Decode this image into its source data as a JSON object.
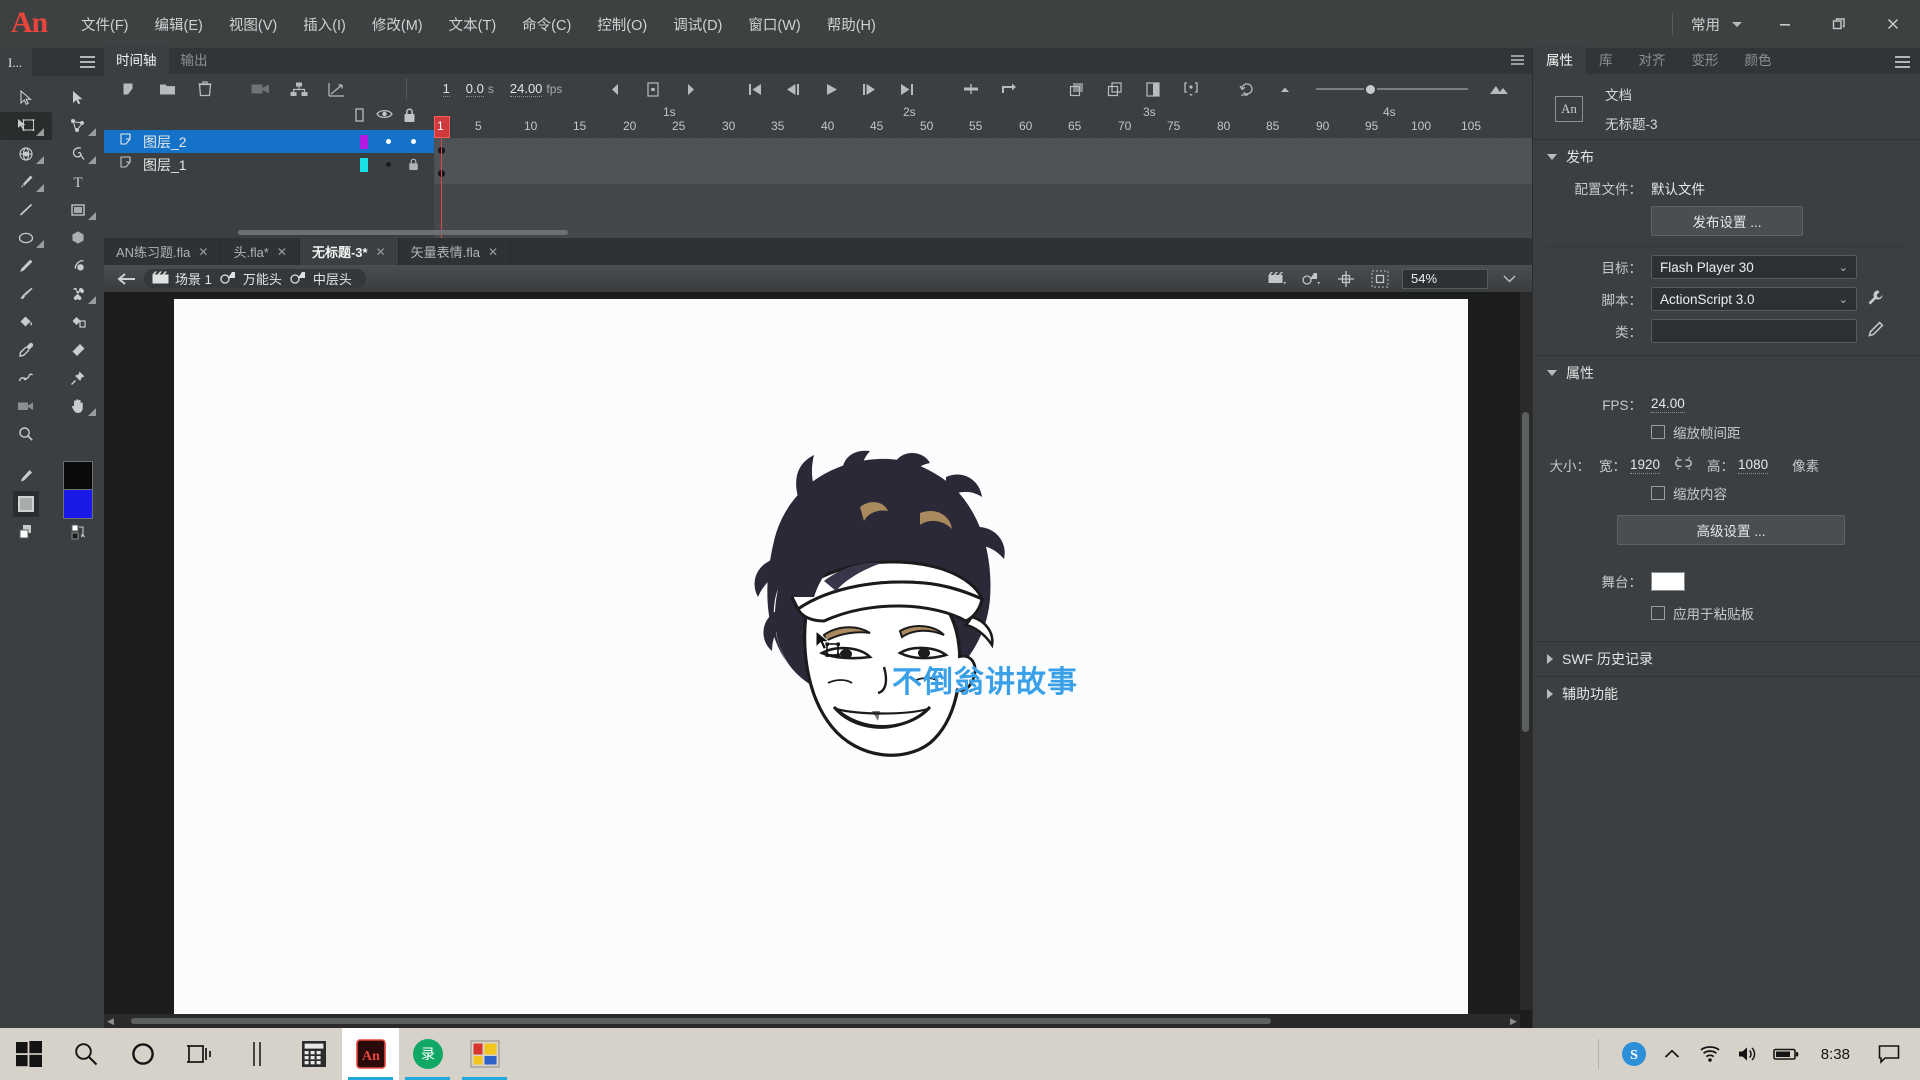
{
  "app": {
    "logo": "An",
    "workspace_label": "常用",
    "window_buttons": {
      "minimize": "minimize-icon",
      "restore": "restore-icon",
      "close": "close-icon"
    }
  },
  "menubar": {
    "items": [
      {
        "label": "文件(F)",
        "name": "menu-file"
      },
      {
        "label": "编辑(E)",
        "name": "menu-edit"
      },
      {
        "label": "视图(V)",
        "name": "menu-view"
      },
      {
        "label": "插入(I)",
        "name": "menu-insert"
      },
      {
        "label": "修改(M)",
        "name": "menu-modify"
      },
      {
        "label": "文本(T)",
        "name": "menu-text"
      },
      {
        "label": "命令(C)",
        "name": "menu-commands"
      },
      {
        "label": "控制(O)",
        "name": "menu-control"
      },
      {
        "label": "调试(D)",
        "name": "menu-debug"
      },
      {
        "label": "窗口(W)",
        "name": "menu-window"
      },
      {
        "label": "帮助(H)",
        "name": "menu-help"
      }
    ]
  },
  "tools": {
    "tab_label": "I...",
    "items": [
      "selection-tool",
      "subselection-tool",
      "free-transform-tool",
      "lasso-tool",
      "gradient-transform-tool",
      "magic-wand-tool",
      "pen-tool",
      "text-tool",
      "line-tool",
      "rectangle-tool",
      "oval-tool",
      "polystar-tool",
      "pencil-tool",
      "paint-brush-tool",
      "brush-tool",
      "bone-tool",
      "paint-bucket-tool",
      "ink-bottle-tool",
      "eyedropper-tool",
      "eraser-tool",
      "width-tool",
      "pin-tool",
      "camera-tool",
      "hand-tool",
      "zoom-tool"
    ],
    "stroke_color": "#0a0a0a",
    "fill_color": "#1a1ae8"
  },
  "timeline": {
    "tabs": [
      {
        "label": "时间轴",
        "active": true
      },
      {
        "label": "输出",
        "active": false
      }
    ],
    "toolbar_icons": [
      "new-layer-icon",
      "new-folder-icon",
      "delete-layer-icon",
      "camera-icon",
      "layer-parenting-icon",
      "easing-icon"
    ],
    "current_frame": "1",
    "time_value": "0.0",
    "time_unit": "s",
    "fps_value": "24.00",
    "fps_unit": "fps",
    "playback_icons": [
      "step-back-icon",
      "loop-icon",
      "step-forward-icon",
      "go-to-start-icon",
      "previous-frame-icon",
      "play-icon",
      "next-frame-icon",
      "go-to-end-icon",
      "center-frame-icon",
      "loop-range-icon",
      "onion-skin-icon",
      "onion-skin-outline-icon",
      "edit-multiple-frames-icon",
      "modify-onion-markers-icon"
    ],
    "right_icons": [
      "reset-timeline-icon",
      "small-frames-icon",
      "large-frames-icon"
    ],
    "zoom_slider_value": 35,
    "column_headers": [
      "frame-column-icon",
      "eye-icon",
      "lock-icon"
    ],
    "layers": [
      {
        "name": "图层_2",
        "selected": true,
        "outline_color": "#b51ae2",
        "visible": true,
        "locked": false
      },
      {
        "name": "图层_1",
        "selected": false,
        "outline_color": "#1ae0e8",
        "visible": false,
        "locked": true
      }
    ],
    "ruler": {
      "second_marks": [
        "1s",
        "2s",
        "3s",
        "4s"
      ],
      "frame_numbers": [
        1,
        5,
        10,
        15,
        20,
        25,
        30,
        35,
        40,
        45,
        50,
        55,
        60,
        65,
        70,
        75,
        80,
        85,
        90,
        95,
        100,
        105
      ]
    }
  },
  "document_tabs": [
    {
      "label": "AN练习题.fla",
      "active": false,
      "close": "✕"
    },
    {
      "label": "头.fla*",
      "active": false,
      "close": "✕"
    },
    {
      "label": "无标题-3*",
      "active": true,
      "close": "✕"
    },
    {
      "label": "矢量表情.fla",
      "active": false,
      "close": "✕"
    }
  ],
  "editbar": {
    "back_icon": "back-arrow-icon",
    "crumbs": [
      {
        "label": "场景 1",
        "icon": "scene-icon"
      },
      {
        "label": "万能头",
        "icon": "symbol-icon"
      },
      {
        "label": "中层头",
        "icon": "symbol-icon"
      }
    ],
    "right_icons": [
      "edit-scene-icon",
      "edit-symbols-icon",
      "center-stage-icon",
      "clip-content-icon"
    ],
    "zoom_value": "54%"
  },
  "stage": {
    "artwork_name": "anime-character-head-illustration",
    "brand_text": "不倒翁讲故事",
    "brand_color": "#3aa0e8",
    "background": "#fbfcfd"
  },
  "properties_panel": {
    "tabs": [
      {
        "label": "属性",
        "active": true
      },
      {
        "label": "库",
        "active": false
      },
      {
        "label": "对齐",
        "active": false
      },
      {
        "label": "变形",
        "active": false
      },
      {
        "label": "颜色",
        "active": false
      }
    ],
    "doc_badge": "An",
    "doc_type": "文档",
    "doc_name": "无标题-3",
    "publish": {
      "section_title": "发布",
      "profile_label": "配置文件：",
      "profile_value": "默认文件",
      "settings_button": "发布设置 ...",
      "target_label": "目标：",
      "target_value": "Flash Player 30",
      "script_label": "脚本：",
      "script_value": "ActionScript 3.0",
      "class_label": "类：",
      "class_value": "",
      "wrench_icon": "wrench-icon",
      "pencil_icon": "pencil-icon"
    },
    "props": {
      "section_title": "属性",
      "fps_label": "FPS：",
      "fps_value": "24.00",
      "scale_spacing_label": "缩放帧间距",
      "scale_spacing_checked": false,
      "size_label": "大小：",
      "width_label": "宽：",
      "width_value": "1920",
      "height_label": "高：",
      "height_value": "1080",
      "unit_label": "像素",
      "link_icon": "link-dimensions-icon",
      "scale_content_label": "缩放内容",
      "scale_content_checked": false,
      "advanced_button": "高级设置 ...",
      "stage_label": "舞台：",
      "stage_color": "#ffffff",
      "pasteboard_label": "应用于粘贴板",
      "pasteboard_checked": false
    },
    "collapsed_sections": [
      {
        "title": "SWF 历史记录"
      },
      {
        "title": "辅助功能"
      }
    ]
  },
  "taskbar": {
    "items": [
      {
        "name": "start-button",
        "icon": "windows-logo-icon"
      },
      {
        "name": "search-button",
        "icon": "search-icon"
      },
      {
        "name": "cortana-button",
        "icon": "circle-icon"
      },
      {
        "name": "task-view-button",
        "icon": "task-view-icon"
      },
      {
        "name": "divider",
        "icon": "divider-icon"
      },
      {
        "name": "calculator-app",
        "icon": "calculator-icon"
      },
      {
        "name": "adobe-animate-app",
        "icon": "an-icon",
        "label": "An",
        "active": true
      },
      {
        "name": "screen-recorder-app",
        "icon": "record-icon",
        "label": "录",
        "running": true
      },
      {
        "name": "image-app",
        "icon": "image-editor-icon",
        "running": true
      }
    ],
    "tray": {
      "sogou_icon": "sogou-input-icon",
      "chevron_icon": "show-hidden-icons-icon",
      "battery_icon": "battery-icon",
      "volume_icon": "volume-icon",
      "network_icon": "network-icon",
      "time": "8:38",
      "notification_icon": "action-center-icon"
    }
  }
}
